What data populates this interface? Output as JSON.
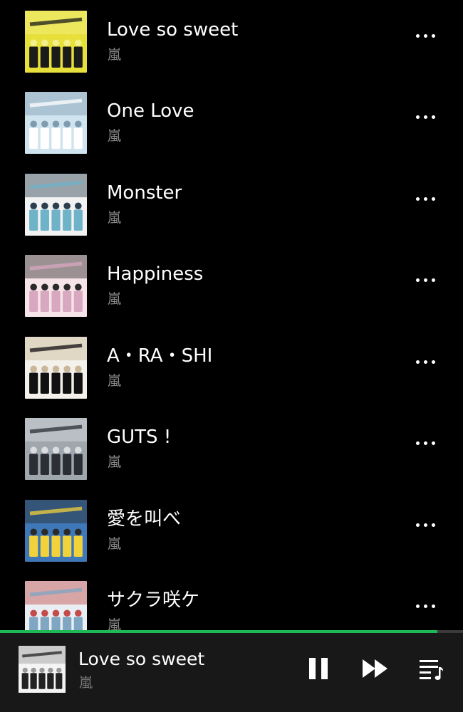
{
  "tracks": [
    {
      "title": "Love so sweet",
      "artist": "嵐",
      "cover": "cover-love-so-sweet",
      "palette": [
        "#e7e03a",
        "#1b1b1b",
        "#f4f08a"
      ]
    },
    {
      "title": "One Love",
      "artist": "嵐",
      "cover": "cover-one-love",
      "palette": [
        "#cfe4ef",
        "#ffffff",
        "#7e9bb0"
      ]
    },
    {
      "title": "Monster",
      "artist": "嵐",
      "cover": "cover-monster",
      "palette": [
        "#f2f2f2",
        "#6fb3c9",
        "#2c3e4f"
      ]
    },
    {
      "title": "Happiness",
      "artist": "嵐",
      "cover": "cover-happiness",
      "palette": [
        "#f7e4e8",
        "#d7a8c0",
        "#2a2a2a"
      ]
    },
    {
      "title": "A・RA・SHI",
      "artist": "嵐",
      "cover": "cover-a-ra-shi",
      "palette": [
        "#f4f1ea",
        "#111111",
        "#c9b79a"
      ]
    },
    {
      "title": "GUTS !",
      "artist": "嵐",
      "cover": "cover-guts",
      "palette": [
        "#9fa6ad",
        "#2b2f35",
        "#d9dde0"
      ]
    },
    {
      "title": "愛を叫べ",
      "artist": "嵐",
      "cover": "cover-ai-wo-sakebe",
      "palette": [
        "#3f78b8",
        "#f2d23a",
        "#2a2a2a"
      ]
    },
    {
      "title": "サクラ咲ケ",
      "artist": "嵐",
      "cover": "cover-sakura-sake",
      "palette": [
        "#e9eef2",
        "#7fa6c3",
        "#c44b4b"
      ]
    }
  ],
  "now_playing": {
    "title": "Love so sweet",
    "artist": "嵐",
    "cover": "cover-now-playing",
    "progress": 0.945,
    "state": "playing",
    "accent_color": "#1db954",
    "palette": [
      "#f4f4f4",
      "#222222",
      "#9a9a9a"
    ]
  },
  "icons": {
    "more": "more-options-icon",
    "pause": "pause-icon",
    "next": "skip-next-icon",
    "queue": "queue-icon"
  }
}
